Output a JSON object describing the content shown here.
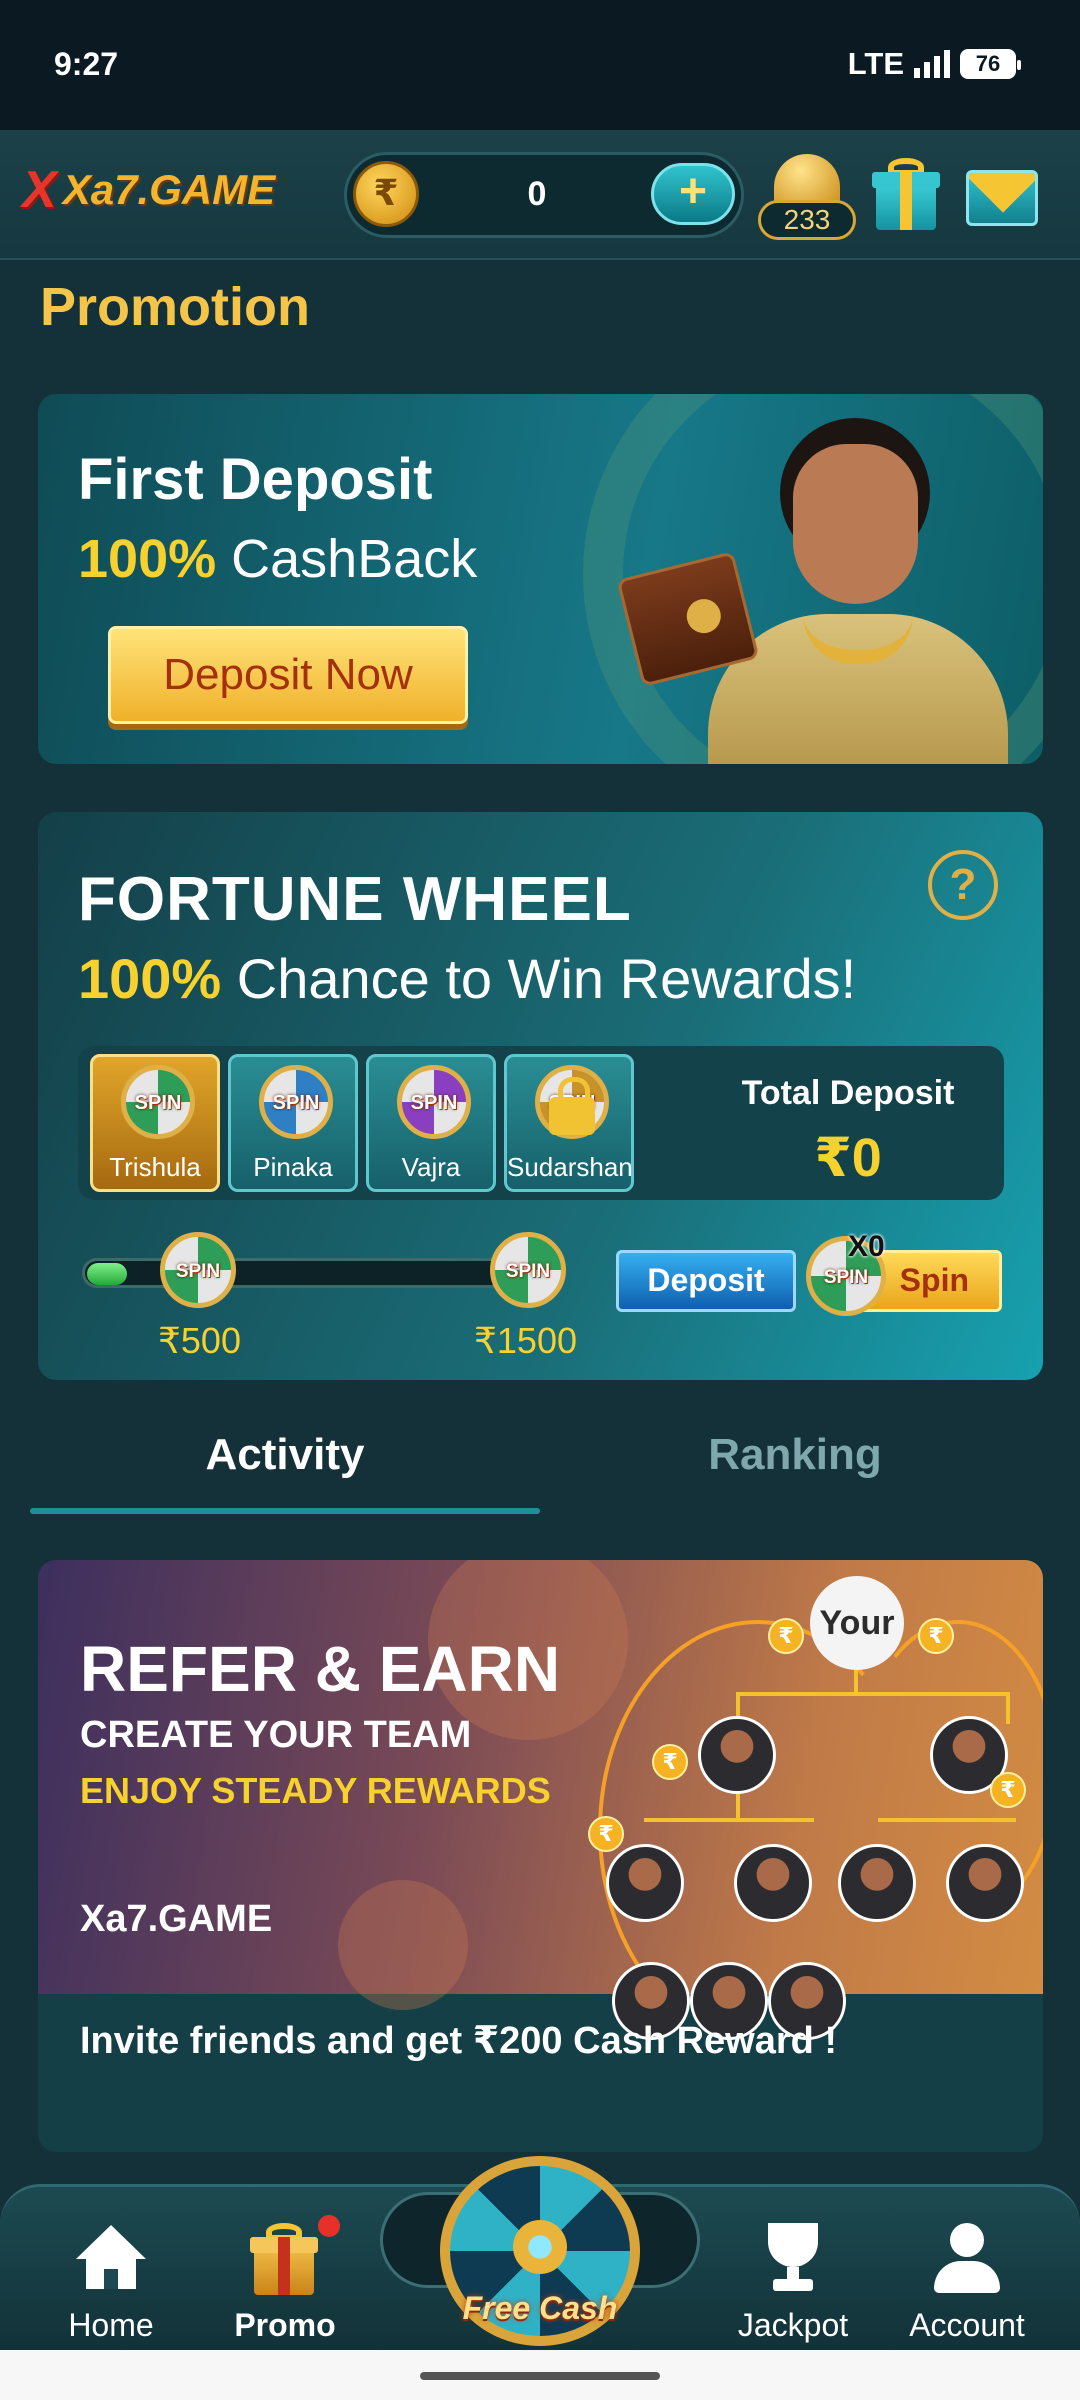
{
  "status_bar": {
    "time": "9:27",
    "network": "LTE",
    "battery": "76"
  },
  "header": {
    "logo_mark": "X",
    "logo_text": "Xa7.GAME",
    "coin_symbol": "₹",
    "balance": "0",
    "add_symbol": "+",
    "bell_count": "233"
  },
  "page": {
    "title": "Promotion"
  },
  "first_deposit": {
    "title": "First Deposit",
    "highlight": "100%",
    "subtitle": "CashBack",
    "button": "Deposit Now"
  },
  "fortune_wheel": {
    "title": "FORTUNE WHEEL",
    "highlight": "100%",
    "subtitle": "Chance to Win Rewards!",
    "help": "?",
    "spin_word": "SPIN",
    "tiers": [
      {
        "label": "Trishula"
      },
      {
        "label": "Pinaka"
      },
      {
        "label": "Vajra"
      },
      {
        "label": "Sudarshan"
      }
    ],
    "total_label": "Total Deposit",
    "total_value": "₹0",
    "progress": 0.03,
    "milestones": [
      "₹500",
      "₹1500"
    ],
    "deposit_button": "Deposit",
    "spin_count": "X0",
    "spin_button": "Spin"
  },
  "tabs": [
    {
      "label": "Activity",
      "active": true
    },
    {
      "label": "Ranking",
      "active": false
    }
  ],
  "refer": {
    "title": "REFER & EARN",
    "line1": "CREATE YOUR TEAM",
    "line2": "ENJOY STEADY REWARDS",
    "logo": "Xa7.GAME",
    "tree_root": "Your",
    "rupee": "₹",
    "caption": "Invite friends and get ₹200 Cash Reward !"
  },
  "bottom_nav": {
    "items": [
      {
        "label": "Home",
        "icon": "home-icon"
      },
      {
        "label": "Promo",
        "icon": "gift-icon",
        "active": true
      },
      {
        "label": "Jackpot",
        "icon": "trophy-icon"
      },
      {
        "label": "Account",
        "icon": "user-icon"
      }
    ],
    "center_label": "Free Cash"
  },
  "colors": {
    "accent_gold": "#f7d12e",
    "bg": "#143038",
    "teal": "#1f8f96"
  }
}
